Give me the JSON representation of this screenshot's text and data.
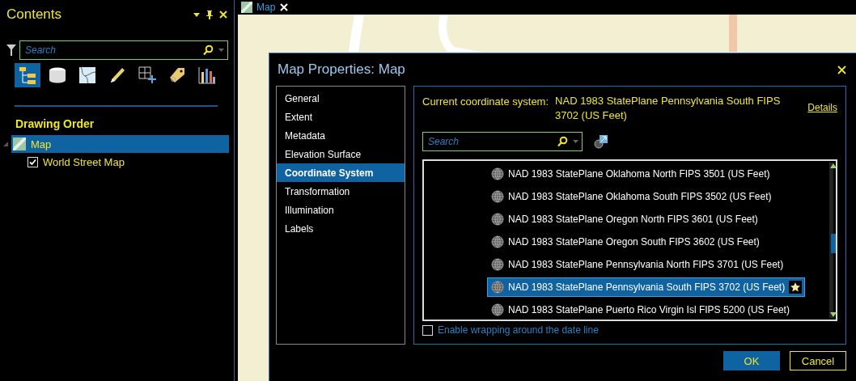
{
  "contents_panel": {
    "title": "Contents",
    "search": {
      "placeholder": "Search"
    },
    "view_buttons": [
      {
        "selected": true
      },
      {
        "selected": false
      },
      {
        "selected": false
      },
      {
        "selected": false
      },
      {
        "selected": false
      },
      {
        "selected": false
      },
      {
        "selected": false
      }
    ],
    "section_title": "Drawing Order",
    "tree": [
      {
        "label": "Map",
        "selected": true,
        "expanded": true,
        "children": [
          {
            "label": "World Street Map",
            "checked": true,
            "selected": false
          }
        ]
      }
    ]
  },
  "map_tab": {
    "label": "Map",
    "selected": true
  },
  "dialog": {
    "title": "Map Properties: Map",
    "nav": [
      {
        "label": "General",
        "selected": false
      },
      {
        "label": "Extent",
        "selected": false
      },
      {
        "label": "Metadata",
        "selected": false
      },
      {
        "label": "Elevation Surface",
        "selected": false
      },
      {
        "label": "Coordinate System",
        "selected": true
      },
      {
        "label": "Transformation",
        "selected": false
      },
      {
        "label": "Illumination",
        "selected": false
      },
      {
        "label": "Labels",
        "selected": false
      }
    ],
    "current_label": "Current coordinate system:",
    "current_value": "NAD 1983 StatePlane Pennsylvania South FIPS 3702 (US Feet)",
    "details_link": "Details",
    "search": {
      "placeholder": "Search"
    },
    "systems": [
      {
        "label": "NAD 1983 StatePlane Oklahoma North FIPS 3501 (US Feet)",
        "selected": false
      },
      {
        "label": "NAD 1983 StatePlane Oklahoma South FIPS 3502 (US Feet)",
        "selected": false
      },
      {
        "label": "NAD 1983 StatePlane Oregon North FIPS 3601 (US Feet)",
        "selected": false
      },
      {
        "label": "NAD 1983 StatePlane Oregon South FIPS 3602 (US Feet)",
        "selected": false
      },
      {
        "label": "NAD 1983 StatePlane Pennsylvania North FIPS 3701 (US Feet)",
        "selected": false
      },
      {
        "label": "NAD 1983 StatePlane Pennsylvania South FIPS 3702 (US Feet)",
        "selected": true
      },
      {
        "label": "NAD 1983 StatePlane Puerto Rico Virgin Isl FIPS 5200 (US Feet)",
        "selected": false
      }
    ],
    "wrap_option": {
      "label": "Enable wrapping around the date line",
      "checked": false
    },
    "buttons": [
      {
        "label": "OK",
        "kind": "primary"
      },
      {
        "label": "Cancel",
        "kind": "secondary"
      }
    ]
  }
}
